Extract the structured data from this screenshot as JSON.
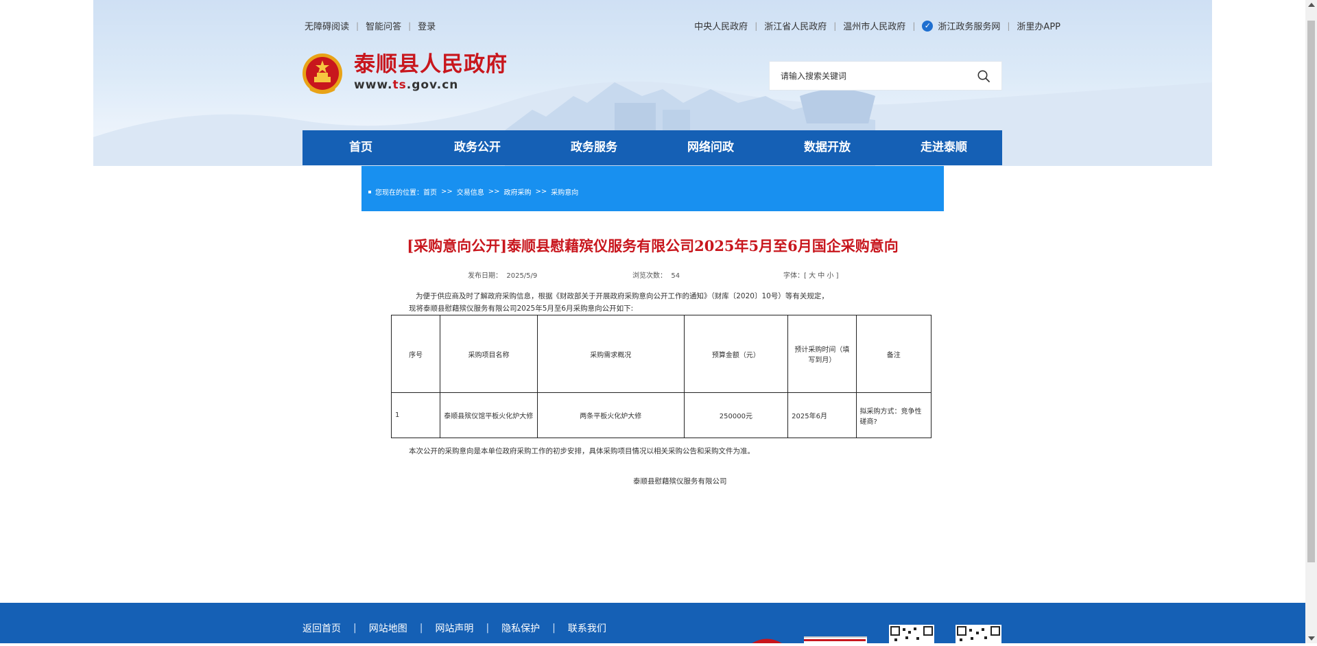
{
  "top_left_links": [
    "无障碍阅读",
    "智能问答",
    "登录"
  ],
  "top_right_links": [
    "中央人民政府",
    "浙江省人民政府",
    "温州市人民政府",
    "浙江政务服务网",
    "浙里办APP"
  ],
  "site": {
    "title": "泰顺县人民政府",
    "url_prefix": "www.",
    "url_highlight": "ts",
    "url_suffix": ".gov.cn"
  },
  "search": {
    "placeholder": "请输入搜索关键词"
  },
  "nav": [
    "首页",
    "政务公开",
    "政务服务",
    "网络问政",
    "数据开放",
    "走进泰顺"
  ],
  "breadcrumb": {
    "label": "您现在的位置：",
    "items": [
      "首页",
      "交易信息",
      "政府采购",
      "采购意向"
    ],
    "separator": ">>"
  },
  "article": {
    "title": "[采购意向公开]泰顺县慰藉殡仪服务有限公司2025年5月至6月国企采购意向",
    "date_label": "发布日期：",
    "date": "2025/5/9",
    "views_label": "浏览次数：",
    "views": "54",
    "font_label": "字体：[ 大 中 小 ]",
    "intro_line1": "为便于供应商及时了解政府采购信息，根据《财政部关于开展政府采购意向公开工作的通知》（财库〔2020〕10号）等有关规定，",
    "intro_line2": "现将泰顺县慰藉殡仪服务有限公司2025年5月至6月采购意向公开如下:",
    "table": {
      "headers": [
        "序号",
        "采购项目名称",
        "采购需求概况",
        "预算金额（元）",
        "预计采购时间（填写到月）",
        "备注"
      ],
      "rows": [
        [
          "1",
          "泰顺县殡仪馆平板火化炉大修",
          "两条平板火化炉大修",
          "250000元",
          "2025年6月",
          "拟采购方式：竞争性磋商?"
        ]
      ]
    },
    "closing": "本次公开的采购意向是本单位政府采购工作的初步安排，具体采购项目情况以相关采购公告和采购文件为准。",
    "signature": "泰顺县慰藉殡仪服务有限公司"
  },
  "footer": {
    "links": [
      "返回首页",
      "网站地图",
      "网站声明",
      "隐私保护",
      "联系我们"
    ]
  },
  "colors": {
    "brand_red": "#c8161d",
    "nav_blue": "#1560b5",
    "breadcrumb_blue": "#1890f0"
  }
}
